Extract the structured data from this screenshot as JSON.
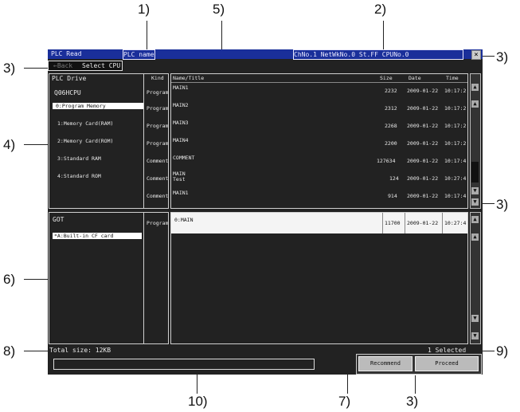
{
  "callouts": [
    "1)",
    "2)",
    "3)",
    "3)",
    "3)",
    "3)",
    "4)",
    "5)",
    "6)",
    "7)",
    "8)",
    "9)",
    "10)"
  ],
  "window": {
    "title": "PLC Read",
    "plc_name_label": "PLC name",
    "channel_info": "ChNo.1 NetWkNo.0 St.FF CPUNo.0",
    "close_symbol": "×"
  },
  "toolbar": {
    "back_label": "←Back",
    "select_cpu_label": "Select CPU"
  },
  "plc": {
    "header_drive": "PLC Drive",
    "header_kind": "Kind",
    "cpu": "Q06HCPU",
    "drives": [
      {
        "label": "0:Program Memory",
        "selected": true
      },
      {
        "label": "1:Memory Card(RAM)"
      },
      {
        "label": "2:Memory Card(ROM)"
      },
      {
        "label": "3:Standard RAM"
      },
      {
        "label": "4:Standard ROM"
      }
    ],
    "kinds": [
      "Program",
      "Program",
      "Program",
      "Program",
      "Comment",
      "Comment",
      "Comment"
    ]
  },
  "files": {
    "header_name": "Name/Title",
    "header_size": "Size",
    "header_date": "Date",
    "header_time": "Time",
    "rows": [
      {
        "name": "MAIN1",
        "title": "",
        "size": "2232",
        "date": "2009-01-22",
        "time": "10:17:2"
      },
      {
        "name": "MAIN2",
        "title": "",
        "size": "2312",
        "date": "2009-01-22",
        "time": "10:17:2"
      },
      {
        "name": "MAIN3",
        "title": "",
        "size": "2268",
        "date": "2009-01-22",
        "time": "10:17:2"
      },
      {
        "name": "MAIN4",
        "title": "",
        "size": "2200",
        "date": "2009-01-22",
        "time": "10:17:2"
      },
      {
        "name": "COMMENT",
        "title": "",
        "size": "127634",
        "date": "2009-01-22",
        "time": "10:17:4"
      },
      {
        "name": "MAIN",
        "title": "Test",
        "size": "124",
        "date": "2009-01-22",
        "time": "10:27:4"
      },
      {
        "name": "MAIN1",
        "title": "",
        "size": "914",
        "date": "2009-01-22",
        "time": "10:17:4"
      }
    ]
  },
  "got": {
    "header": "GOT",
    "kind": "Program",
    "drive": "*A:Built-in CF card"
  },
  "got_files": {
    "rows": [
      {
        "name": "0:MAIN",
        "size": "11700",
        "date": "2009-01-22",
        "time": "10:27:4"
      }
    ]
  },
  "status": {
    "total_size": "Total size: 12KB",
    "selected": "1 Selected",
    "message": ""
  },
  "buttons": {
    "recommend": "Recommend",
    "proceed": "Proceed"
  },
  "colors": {
    "title_bar": "#1a2f9a",
    "screen_bg": "#222222",
    "selection": "#ffffff"
  }
}
